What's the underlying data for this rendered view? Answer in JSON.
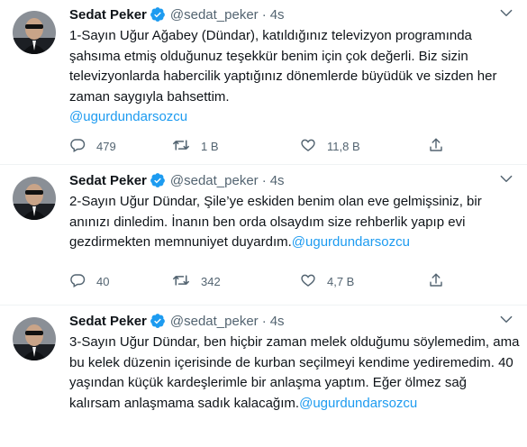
{
  "tweets": [
    {
      "name": "Sedat Peker",
      "handle": "@sedat_peker",
      "separator": "·",
      "time": "4s",
      "text": "1-Sayın Uğur Ağabey (Dündar), katıldığınız televizyon programında şahsıma etmiş olduğunuz teşekkür benim için çok değerli. Biz sizin televizyonlarda habercilik yaptığınız dönemlerde büyüdük ve sizden her zaman saygıyla bahsettim.",
      "mention": "@ugurdundarsozcu",
      "replies": "479",
      "retweets": "1 B",
      "likes": "11,8 B"
    },
    {
      "name": "Sedat Peker",
      "handle": "@sedat_peker",
      "separator": "·",
      "time": "4s",
      "text": "2-Sayın Uğur Dündar, Şile’ye eskiden benim olan eve gelmişsiniz, bir anınızı dinledim. İnanın ben orda olsaydım size rehberlik yapıp evi gezdirmekten memnuniyet duyardım.",
      "mention": "@ugurdundarsozcu",
      "replies": "40",
      "retweets": "342",
      "likes": "4,7 B"
    },
    {
      "name": "Sedat Peker",
      "handle": "@sedat_peker",
      "separator": "·",
      "time": "4s",
      "text": "3-Sayın Uğur Dündar, ben hiçbir zaman melek olduğumu söylemedim, ama bu kelek düzenin içerisinde de kurban seçilmeyi kendime yediremedim. 40 yaşından küçük kardeşlerimle bir anlaşma yaptım. Eğer ölmez sağ kalırsam anlaşmama sadık kalacağım.",
      "mention": "@ugurdundarsozcu"
    }
  ],
  "colors": {
    "accent": "#1d9bf0",
    "text": "#0f1419",
    "muted": "#536471",
    "divider": "#eff3f4"
  },
  "icons": [
    "verified-badge-icon",
    "more-icon",
    "reply-icon",
    "retweet-icon",
    "like-icon",
    "share-icon"
  ]
}
